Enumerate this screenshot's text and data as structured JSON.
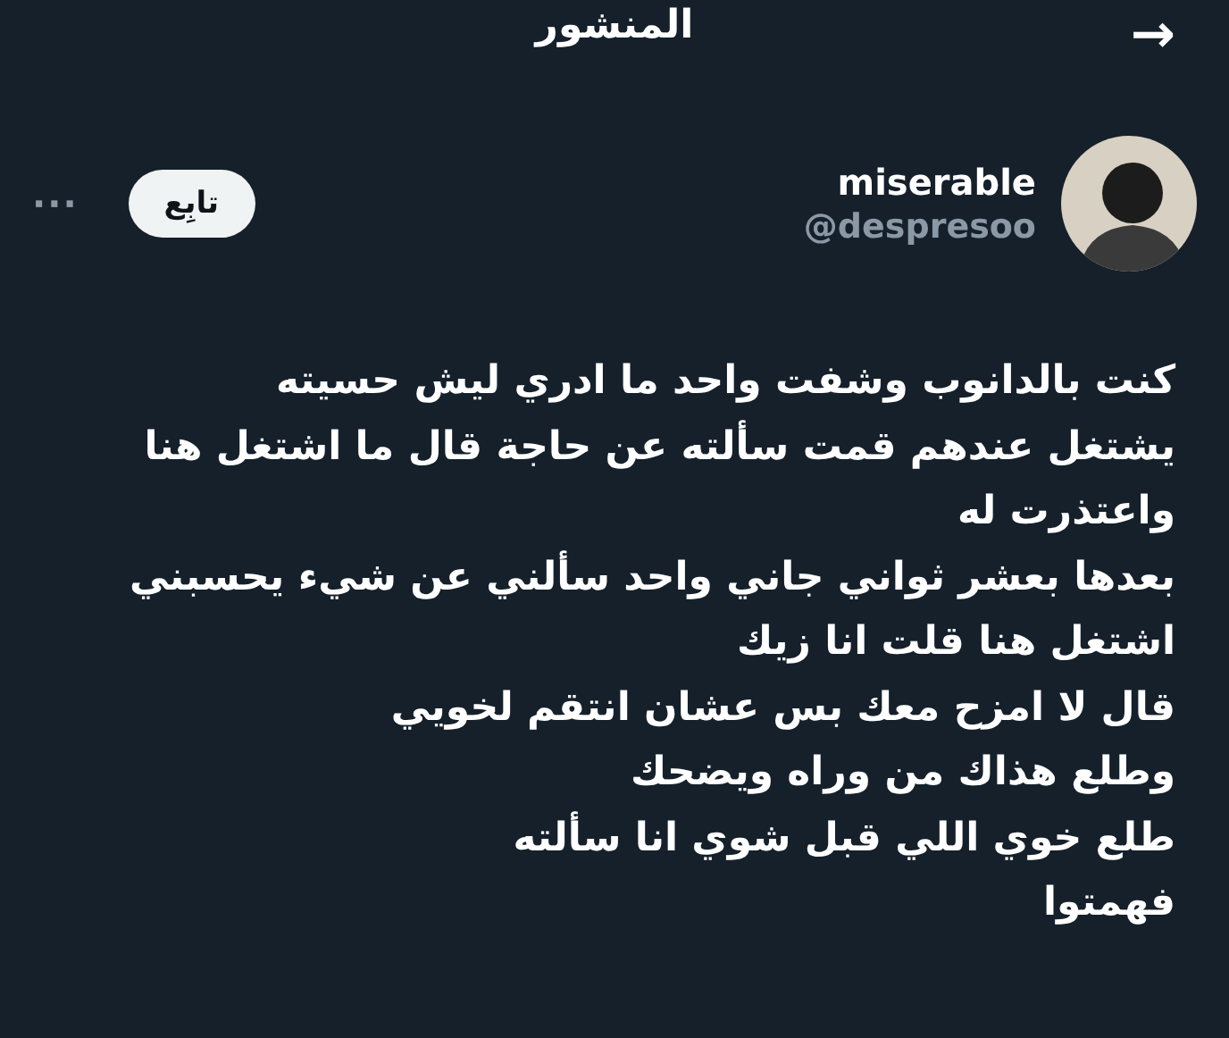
{
  "header": {
    "title": "المنشور",
    "back_icon": "→"
  },
  "author": {
    "name": "miserable",
    "handle": "@despresoo"
  },
  "follow_button": {
    "label": "تابِع"
  },
  "more_icon": "···",
  "post": {
    "text": "كنت بالدانوب وشفت واحد ما ادري ليش حسيته\nيشتغل عندهم قمت سألته عن حاجة قال ما اشتغل هنا\nواعتذرت له\nبعدها بعشر ثواني جاني واحد سألني عن شيء يحسبني\nاشتغل هنا قلت انا زيك\n قال لا امزح معك بس عشان انتقم لخويي\nوطلع هذاك من وراه ويضحك\nطلع خوي اللي قبل شوي انا سألته\nفهمتوا"
  }
}
